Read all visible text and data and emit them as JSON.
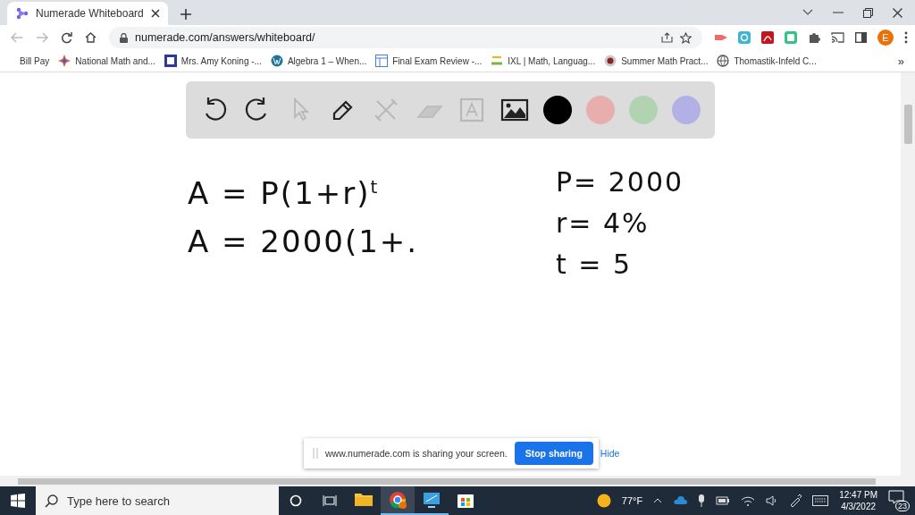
{
  "browser": {
    "tab": {
      "title": "Numerade Whiteboard",
      "selected": true
    },
    "address": {
      "url": "numerade.com/answers/whiteboard/"
    },
    "profile": {
      "initial": "E"
    },
    "bookmarks": [
      {
        "kind": "plain",
        "label": "Bill Pay"
      },
      {
        "kind": "star",
        "label": "National Math and..."
      },
      {
        "kind": "square",
        "label": "Mrs. Amy Koning -..."
      },
      {
        "kind": "wp",
        "label": "Algebra 1 – When..."
      },
      {
        "kind": "form",
        "label": "Final Exam Review -..."
      },
      {
        "kind": "ixl",
        "label": "IXL | Math, Languag..."
      },
      {
        "kind": "seal",
        "label": "Summer Math Pract..."
      },
      {
        "kind": "globe",
        "label": "Thomastik-Infeld C..."
      }
    ],
    "more": "»"
  },
  "whiteboard": {
    "tools": [
      {
        "kind": "undo",
        "disabled": false
      },
      {
        "kind": "redo",
        "disabled": false
      },
      {
        "kind": "pointer",
        "disabled": true
      },
      {
        "kind": "pen",
        "disabled": false
      },
      {
        "kind": "tools",
        "disabled": true
      },
      {
        "kind": "eraser",
        "disabled": true
      },
      {
        "kind": "text",
        "disabled": true
      },
      {
        "kind": "image",
        "disabled": false
      }
    ],
    "colors": [
      {
        "color": "#000000"
      },
      {
        "color": "#e8aeae"
      },
      {
        "color": "#b1d3b1"
      },
      {
        "color": "#b1b1e6"
      }
    ],
    "ink": [
      {
        "kind": "left",
        "text": "A = P(1+r)$^{t}$"
      },
      {
        "kind": "left",
        "text": "A = 2000(1+."
      },
      {
        "kind": "right",
        "text": "P= 2000"
      },
      {
        "kind": "right",
        "text": "r=  4%"
      },
      {
        "kind": "right",
        "text": "t =  5"
      }
    ]
  },
  "share_bar": {
    "message": "www.numerade.com is sharing your screen.",
    "stop_button": "Stop sharing",
    "hide_link": "Hide"
  },
  "taskbar": {
    "search": {
      "placeholder": "Type here to search"
    },
    "apps": [
      {
        "kind": "explorer",
        "active": false,
        "running": false
      },
      {
        "kind": "chrome",
        "active": true,
        "running": true
      },
      {
        "kind": "remote",
        "active": false,
        "running": true
      },
      {
        "kind": "store",
        "active": false,
        "running": false
      }
    ],
    "weather": "77°F",
    "time": "12:47 PM",
    "date": "4/3/2022",
    "notifications": "23"
  }
}
